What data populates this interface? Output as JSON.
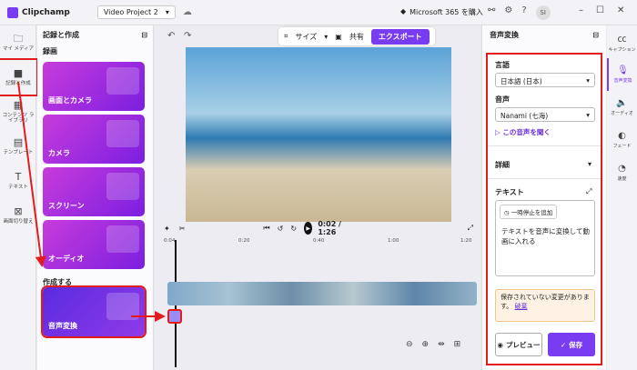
{
  "titlebar": {
    "app": "Clipchamp",
    "project": "Video Project 2",
    "ms365": "Microsoft 365 を購入",
    "avatar": "SI"
  },
  "leftrail": {
    "items": [
      {
        "label": "マイ メディア",
        "icon": "folder-icon"
      },
      {
        "label": "記録と作成",
        "icon": "camera-icon"
      },
      {
        "label": "コンテンツ ライブラリ",
        "icon": "library-icon"
      },
      {
        "label": "テンプレート",
        "icon": "template-icon"
      },
      {
        "label": "テキスト",
        "icon": "text-icon"
      },
      {
        "label": "画面切り替え",
        "icon": "transition-icon"
      }
    ]
  },
  "panel": {
    "title": "記録と作成",
    "record_label": "録画",
    "create_label": "作成する",
    "cards": [
      "画面とカメラ",
      "カメラ",
      "スクリーン",
      "オーディオ"
    ],
    "tts_card": "音声変換"
  },
  "toolbar": {
    "size": "サイズ",
    "share": "共有",
    "export": "エクスポート"
  },
  "player": {
    "time": "0:02 / 1:26",
    "ticks": [
      "0:04",
      "0:20",
      "0:40",
      "1:00",
      "1:20"
    ]
  },
  "rightpanel": {
    "title": "音声変換",
    "language_label": "言語",
    "language_value": "日本語 (日本)",
    "voice_label": "音声",
    "voice_value": "Nanami (七海)",
    "listen_link": "この音声を聞く",
    "details_label": "詳細",
    "text_label": "テキスト",
    "pause_chip": "一時停止を追加",
    "text_value": "テキストを音声に変換して動画に入れる",
    "warning_text": "保存されていない変更があります。",
    "warning_link": "破棄",
    "preview_btn": "プレビュー",
    "save_btn": "保存"
  },
  "rightrail": {
    "items": [
      {
        "label": "キャプション",
        "icon": "caption-icon"
      },
      {
        "label": "音声変換",
        "icon": "microphone-icon"
      },
      {
        "label": "オーディオ",
        "icon": "speaker-icon"
      },
      {
        "label": "フェード",
        "icon": "fade-icon"
      },
      {
        "label": "速度",
        "icon": "speed-icon"
      }
    ]
  },
  "colors": {
    "accent": "#7a3cf0",
    "highlight": "#e21c1c"
  }
}
